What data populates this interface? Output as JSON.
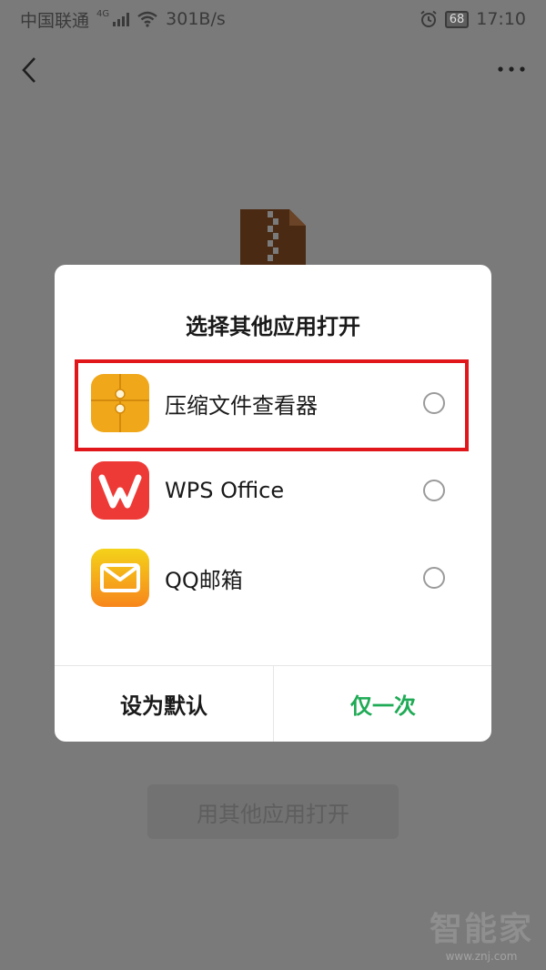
{
  "status_bar": {
    "carrier": "中国联通",
    "network_type": "4G",
    "speed": "301B/s",
    "battery": "68",
    "time": "17:10"
  },
  "app_bar": {
    "back_icon": "chevron-left-icon",
    "more_icon": "more-horizontal-icon"
  },
  "background": {
    "open_with_button": "用其他应用打开",
    "file_icon": "zip-file-icon"
  },
  "dialog": {
    "title": "选择其他应用打开",
    "apps": [
      {
        "name": "压缩文件查看器",
        "icon": "zip-viewer-app-icon",
        "color": "#f0a81a",
        "selected": false
      },
      {
        "name": "WPS Office",
        "icon": "wps-office-app-icon",
        "color": "#ee3a36",
        "selected": false
      },
      {
        "name": "QQ邮箱",
        "icon": "qq-mail-app-icon",
        "color": "#f7b11b",
        "selected": false
      }
    ],
    "buttons": {
      "set_default": "设为默认",
      "just_once": "仅一次"
    },
    "accent_color": "#1faa55",
    "highlight_color": "#e0161b"
  },
  "watermark": {
    "main": "智能家",
    "sub": "www.znj.com"
  }
}
